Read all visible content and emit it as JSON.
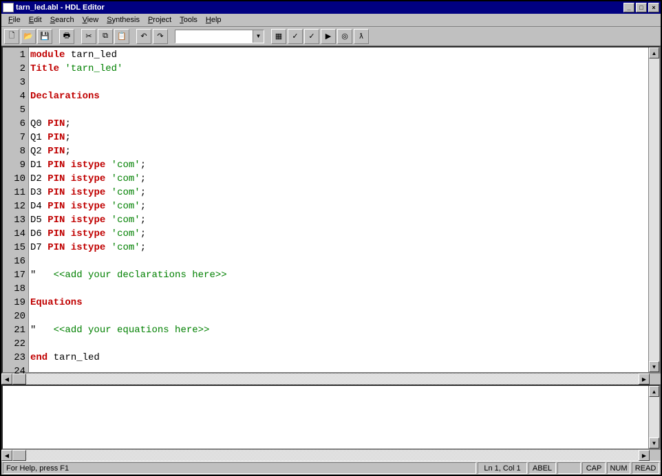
{
  "title": "tarn_led.abl - HDL Editor",
  "menu": [
    "File",
    "Edit",
    "Search",
    "View",
    "Synthesis",
    "Project",
    "Tools",
    "Help"
  ],
  "toolbar_icons": [
    "new",
    "open",
    "save",
    "print",
    "cut",
    "copy",
    "paste",
    "undo",
    "redo"
  ],
  "toolbar_icons2": [
    "compile",
    "check",
    "check2",
    "arrow",
    "target",
    "lambda"
  ],
  "combo_value": "",
  "code_lines": [
    {
      "n": 1,
      "segs": [
        {
          "t": "module",
          "c": "kw"
        },
        {
          "t": " tarn_led"
        }
      ]
    },
    {
      "n": 2,
      "segs": [
        {
          "t": "Title",
          "c": "kw"
        },
        {
          "t": " "
        },
        {
          "t": "'tarn_led'",
          "c": "str"
        }
      ]
    },
    {
      "n": 3,
      "segs": []
    },
    {
      "n": 4,
      "segs": [
        {
          "t": "Declarations",
          "c": "kw"
        }
      ]
    },
    {
      "n": 5,
      "segs": []
    },
    {
      "n": 6,
      "segs": [
        {
          "t": "Q0 "
        },
        {
          "t": "PIN",
          "c": "kw"
        },
        {
          "t": ";"
        }
      ]
    },
    {
      "n": 7,
      "segs": [
        {
          "t": "Q1 "
        },
        {
          "t": "PIN",
          "c": "kw"
        },
        {
          "t": ";"
        }
      ]
    },
    {
      "n": 8,
      "segs": [
        {
          "t": "Q2 "
        },
        {
          "t": "PIN",
          "c": "kw"
        },
        {
          "t": ";"
        }
      ]
    },
    {
      "n": 9,
      "segs": [
        {
          "t": "D1 "
        },
        {
          "t": "PIN",
          "c": "kw"
        },
        {
          "t": " "
        },
        {
          "t": "istype",
          "c": "kw"
        },
        {
          "t": " "
        },
        {
          "t": "'com'",
          "c": "str"
        },
        {
          "t": ";"
        }
      ]
    },
    {
      "n": 10,
      "segs": [
        {
          "t": "D2 "
        },
        {
          "t": "PIN",
          "c": "kw"
        },
        {
          "t": " "
        },
        {
          "t": "istype",
          "c": "kw"
        },
        {
          "t": " "
        },
        {
          "t": "'com'",
          "c": "str"
        },
        {
          "t": ";"
        }
      ]
    },
    {
      "n": 11,
      "segs": [
        {
          "t": "D3 "
        },
        {
          "t": "PIN",
          "c": "kw"
        },
        {
          "t": " "
        },
        {
          "t": "istype",
          "c": "kw"
        },
        {
          "t": " "
        },
        {
          "t": "'com'",
          "c": "str"
        },
        {
          "t": ";"
        }
      ]
    },
    {
      "n": 12,
      "segs": [
        {
          "t": "D4 "
        },
        {
          "t": "PIN",
          "c": "kw"
        },
        {
          "t": " "
        },
        {
          "t": "istype",
          "c": "kw"
        },
        {
          "t": " "
        },
        {
          "t": "'com'",
          "c": "str"
        },
        {
          "t": ";"
        }
      ]
    },
    {
      "n": 13,
      "segs": [
        {
          "t": "D5 "
        },
        {
          "t": "PIN",
          "c": "kw"
        },
        {
          "t": " "
        },
        {
          "t": "istype",
          "c": "kw"
        },
        {
          "t": " "
        },
        {
          "t": "'com'",
          "c": "str"
        },
        {
          "t": ";"
        }
      ]
    },
    {
      "n": 14,
      "segs": [
        {
          "t": "D6 "
        },
        {
          "t": "PIN",
          "c": "kw"
        },
        {
          "t": " "
        },
        {
          "t": "istype",
          "c": "kw"
        },
        {
          "t": " "
        },
        {
          "t": "'com'",
          "c": "str"
        },
        {
          "t": ";"
        }
      ]
    },
    {
      "n": 15,
      "segs": [
        {
          "t": "D7 "
        },
        {
          "t": "PIN",
          "c": "kw"
        },
        {
          "t": " "
        },
        {
          "t": "istype",
          "c": "kw"
        },
        {
          "t": " "
        },
        {
          "t": "'com'",
          "c": "str"
        },
        {
          "t": ";"
        }
      ]
    },
    {
      "n": 16,
      "segs": []
    },
    {
      "n": 17,
      "segs": [
        {
          "t": "\" "
        },
        {
          "t": "  <<add your declarations here>>",
          "c": "str"
        }
      ]
    },
    {
      "n": 18,
      "segs": []
    },
    {
      "n": 19,
      "segs": [
        {
          "t": "Equations",
          "c": "kw"
        }
      ]
    },
    {
      "n": 20,
      "segs": []
    },
    {
      "n": 21,
      "segs": [
        {
          "t": "\" "
        },
        {
          "t": "  <<add your equations here>>",
          "c": "str"
        }
      ]
    },
    {
      "n": 22,
      "segs": []
    },
    {
      "n": 23,
      "segs": [
        {
          "t": "end",
          "c": "kw"
        },
        {
          "t": " tarn_led"
        }
      ]
    },
    {
      "n": 24,
      "segs": []
    }
  ],
  "status": {
    "help": "For Help, press F1",
    "pos": "Ln 1, Col 1",
    "mode": "ABEL",
    "blank": "",
    "cap": "CAP",
    "num": "NUM",
    "read": "READ"
  }
}
